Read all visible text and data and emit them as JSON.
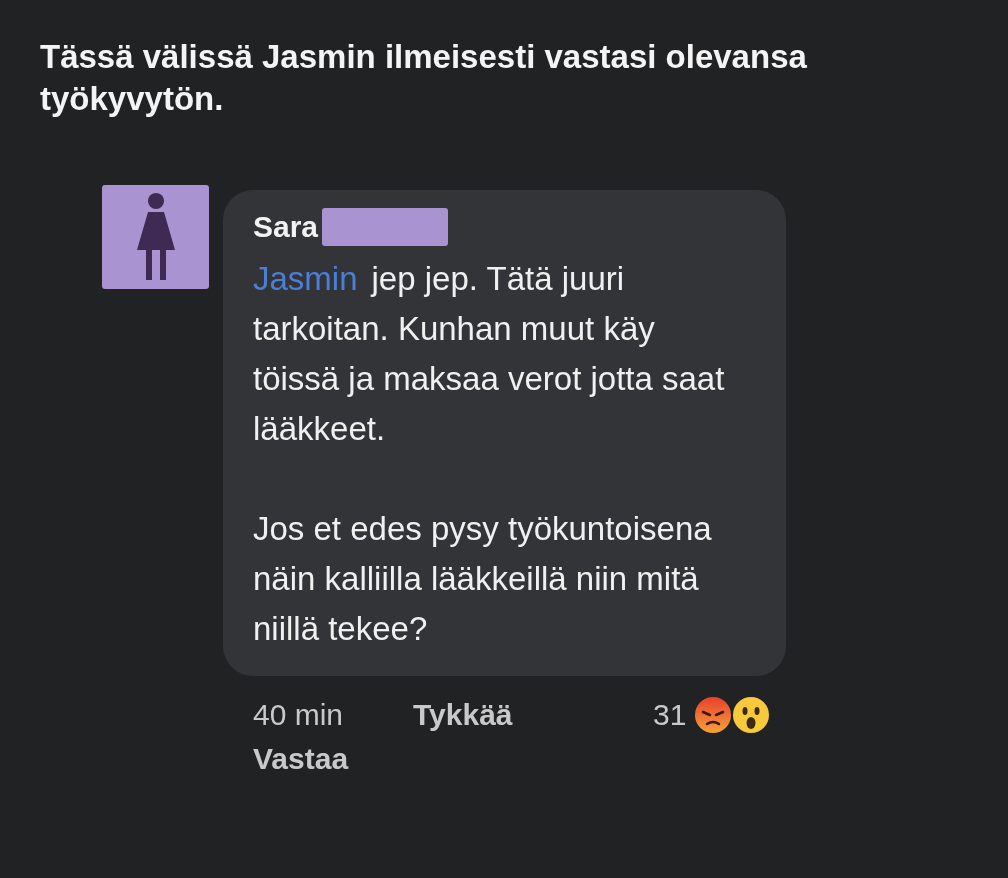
{
  "caption": "Tässä välissä Jasmin ilmeisesti vastasi olevansa työkyvytön.",
  "comment": {
    "author": "Sara",
    "mention": "Jasmin",
    "paragraphs": [
      "jep jep. Tätä juuri tarkoitan. Kunhan muut käy töissä ja maksaa verot jotta saat lääkkeet.",
      "Jos et edes pysy työkuntoisena näin kalliilla lääkkeillä niin mitä niillä tekee?"
    ],
    "time": "40 min",
    "like_label": "Tykkää",
    "reply_label": "Vastaa",
    "reaction_count": "31"
  }
}
